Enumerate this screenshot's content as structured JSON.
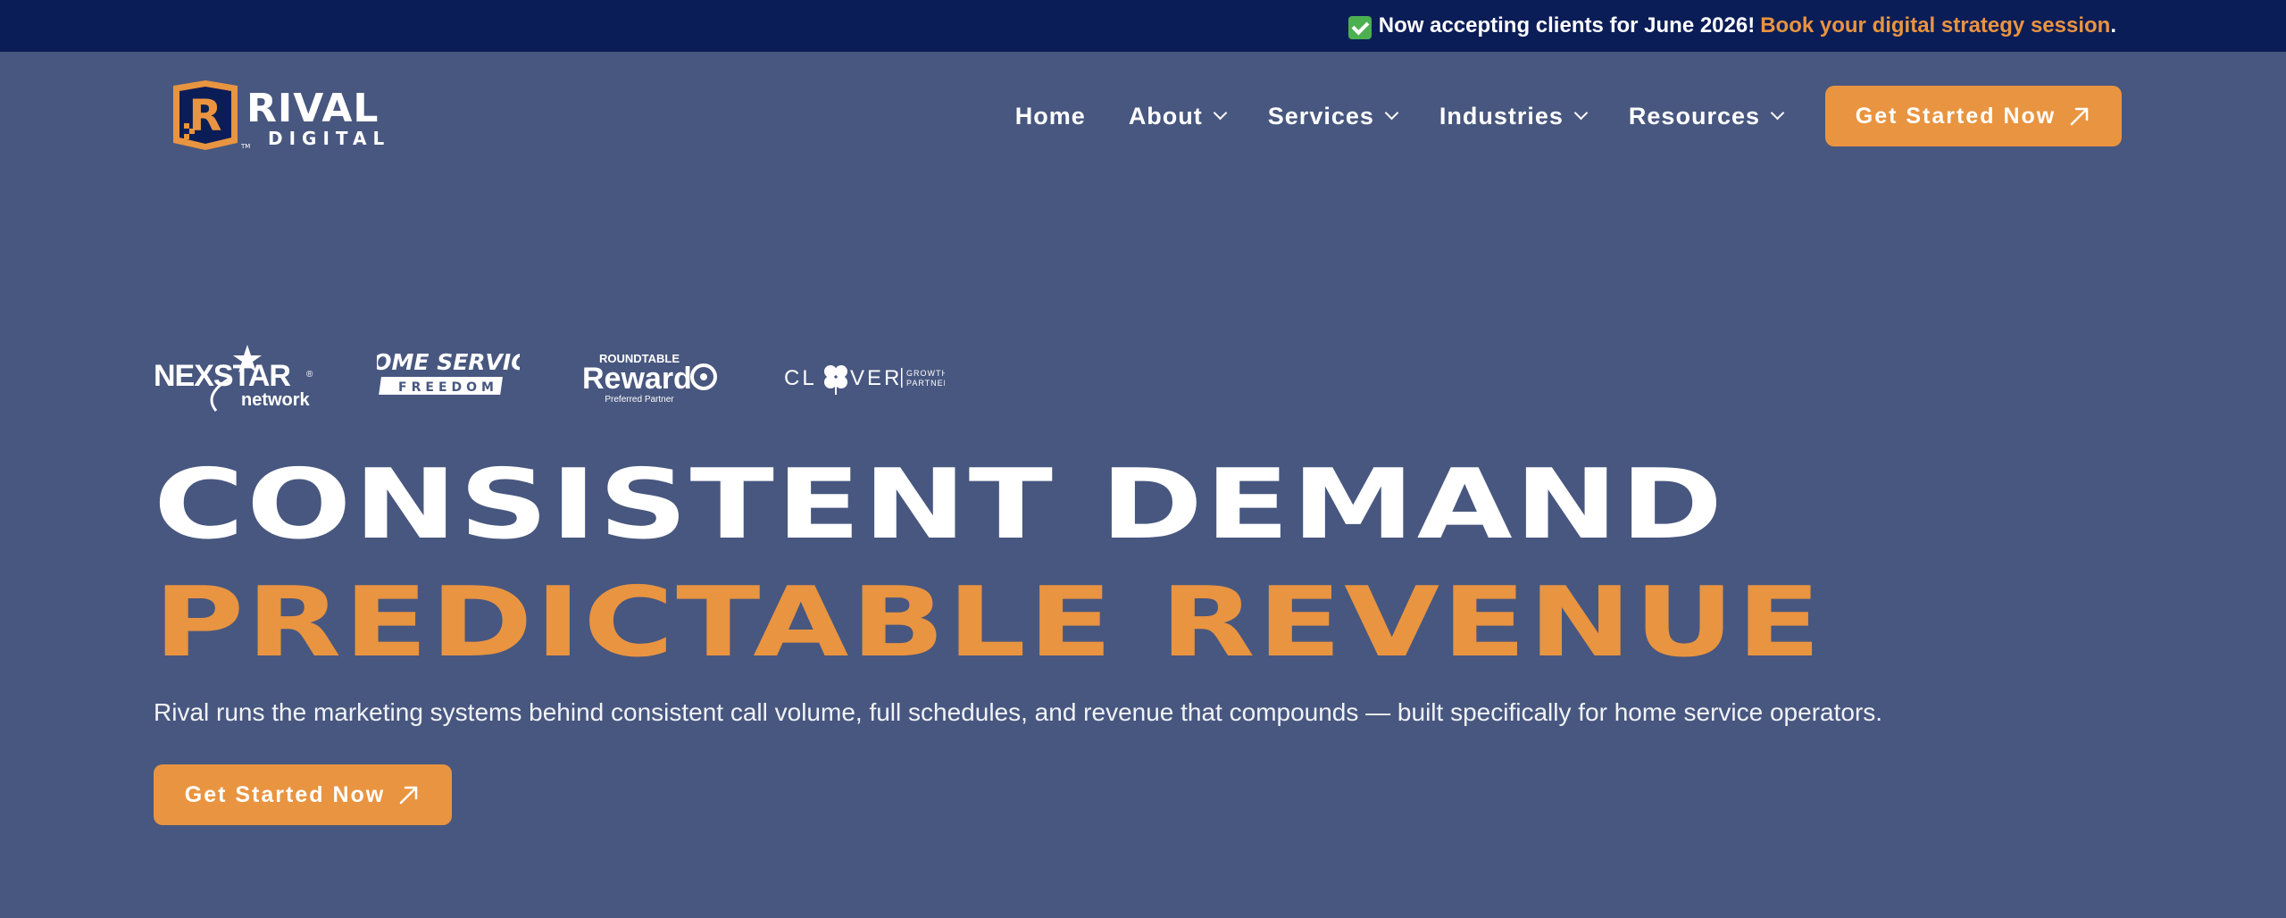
{
  "announcement": {
    "text": "Now accepting clients for June 2026!",
    "link_text": "Book your digital strategy session",
    "suffix": ".",
    "icon": "check-mark-icon"
  },
  "brand": {
    "name_top": "RIVAL",
    "name_bottom": "DIGITAL",
    "monogram": "R",
    "tm": "TM"
  },
  "nav": {
    "items": [
      {
        "label": "Home",
        "has_dropdown": false
      },
      {
        "label": "About",
        "has_dropdown": true
      },
      {
        "label": "Services",
        "has_dropdown": true
      },
      {
        "label": "Industries",
        "has_dropdown": true
      },
      {
        "label": "Resources",
        "has_dropdown": true
      }
    ],
    "cta_label": "Get Started Now"
  },
  "partners": {
    "nexstar": {
      "name": "NEXSTAR",
      "sub": "network",
      "reg": "®"
    },
    "hsf": {
      "line1": "HOME SERVICE",
      "line2": "FREEDOM"
    },
    "reward": {
      "top": "ROUNDTABLE",
      "main": "Reward",
      "sub": "Preferred Partner"
    },
    "clover": {
      "pre": "CL",
      "post": "VER",
      "sub1": "GROWTH",
      "sub2": "PARTNERS"
    }
  },
  "hero": {
    "headline_line1": "CONSISTENT DEMAND",
    "headline_line2": "PREDICTABLE REVENUE",
    "subtext": "Rival runs the marketing systems behind consistent call volume, full schedules, and revenue that compounds — built specifically for home service operators.",
    "cta_label": "Get Started Now"
  },
  "colors": {
    "background": "#48577f",
    "announcement_bar": "#0b1d57",
    "accent": "#e99440",
    "text": "#ffffff"
  }
}
